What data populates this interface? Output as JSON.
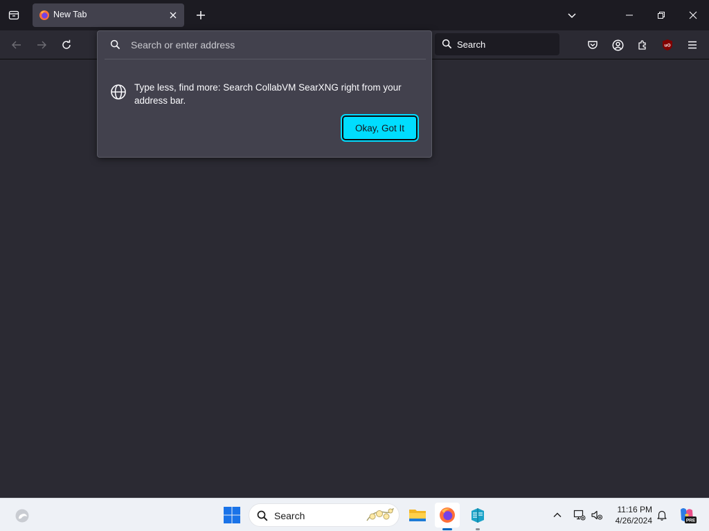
{
  "browser": {
    "tab": {
      "title": "New Tab"
    },
    "searchbox": {
      "label": "Search"
    },
    "urlbar": {
      "placeholder": "Search or enter address"
    },
    "tip": {
      "message": "Type less, find more: Search CollabVM SearXNG right from your address bar.",
      "button_label": "Okay, Got It"
    },
    "extensions": {
      "ublock_badge": "uO"
    }
  },
  "taskbar": {
    "search_label": "Search",
    "apps": [
      "file-explorer",
      "firefox",
      "app-3"
    ],
    "clock": {
      "time": "11:16 PM",
      "date": "4/26/2024"
    },
    "copilot_badge": "PRE"
  },
  "colors": {
    "accent": "#00ddff",
    "chrome_bg": "#1c1b22",
    "content_bg": "#2b2a33",
    "popup_bg": "#42414d"
  }
}
